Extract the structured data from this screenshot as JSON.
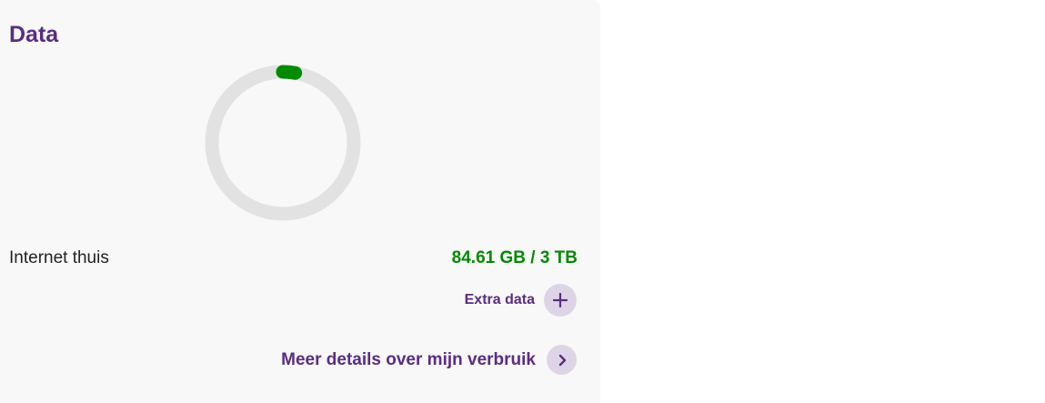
{
  "card": {
    "title": "Data"
  },
  "gauge": {
    "used_fraction": 0.028,
    "track_color": "#e2e2e2",
    "fill_color": "#008a00"
  },
  "usage": {
    "label": "Internet thuis",
    "value": "84.61 GB / 3 TB"
  },
  "actions": {
    "extra_data": {
      "label": "Extra data",
      "icon": "plus-icon"
    },
    "details": {
      "label": "Meer details over mijn verbruik",
      "icon": "chevron-right-icon"
    }
  },
  "colors": {
    "brand_purple": "#5a2d82",
    "usage_green": "#008a00",
    "icon_bg": "#ddd5e6"
  }
}
